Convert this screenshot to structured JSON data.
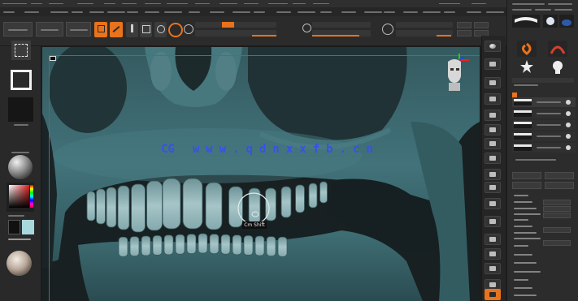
{
  "canvas": {
    "tooltip": "Cm Shift"
  },
  "watermark": {
    "brand": "CG",
    "url": "www.qdnxxfb.cn"
  },
  "colors": {
    "background": "#1d1d1d",
    "panel": "#2c2c2c",
    "accent": "#e8731c",
    "skull": "#3d6a70",
    "teeth": "#9bbcc0",
    "watermark": "#3552e8",
    "swatch_primary": "#111111",
    "swatch_secondary": "#a8d8dc"
  },
  "icons": {
    "left_shelf": [
      "selection-rect-icon",
      "mask-rect-icon",
      "alpha-icon",
      "material-sphere-icon",
      "color-picker-icon",
      "color-swatch-icon",
      "matcap-sphere-icon"
    ],
    "toolbar": [
      "edit-mode-icon",
      "draw-mode-icon",
      "move-icon",
      "scale-icon",
      "rotate-icon",
      "brush-ring-icon",
      "focal-icon"
    ],
    "right_tray": "view-control-icon",
    "gizmo": "orientation-head-icon",
    "cursor": "brush-cursor-icon"
  }
}
